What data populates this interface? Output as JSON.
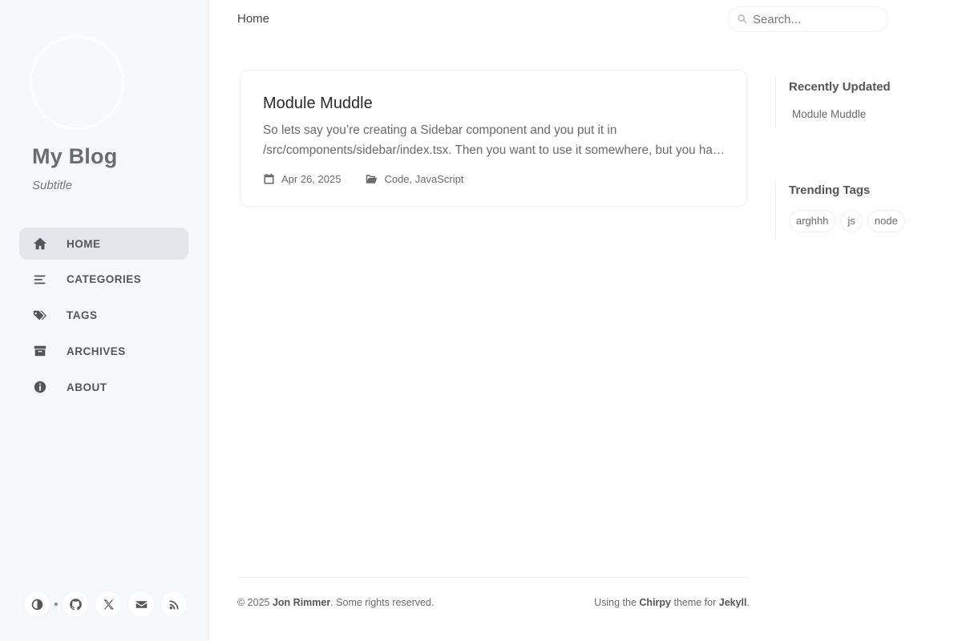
{
  "sidebar": {
    "site_title": "My Blog",
    "subtitle": "Subtitle",
    "nav": [
      {
        "label": "HOME",
        "icon": "home-icon",
        "active": true
      },
      {
        "label": "CATEGORIES",
        "icon": "stream-icon",
        "active": false
      },
      {
        "label": "TAGS",
        "icon": "tags-icon",
        "active": false
      },
      {
        "label": "ARCHIVES",
        "icon": "archive-icon",
        "active": false
      },
      {
        "label": "ABOUT",
        "icon": "info-circle-icon",
        "active": false
      }
    ],
    "bottom_icons": [
      "theme-toggle-icon",
      "github-icon",
      "x-twitter-icon",
      "email-icon",
      "rss-icon"
    ]
  },
  "topbar": {
    "breadcrumb": "Home",
    "search_placeholder": "Search..."
  },
  "post": {
    "title": "Module Muddle",
    "excerpt_line1": "So lets say you’re creating a Sidebar component and you put it in",
    "excerpt_line2": "/src/components/sidebar/index.tsx. Then you want to use it somewhere, but you have to import it from",
    "date": "Apr 26, 2025",
    "categories": [
      "Code",
      "JavaScript"
    ]
  },
  "panel": {
    "recent_heading": "Recently Updated",
    "recent_items": [
      "Module Muddle"
    ],
    "tags_heading": "Trending Tags",
    "tags": [
      "arghhh",
      "js",
      "node"
    ]
  },
  "footer": {
    "copyright_prefix": "© 2025 ",
    "author": "Jon Rimmer",
    "copyright_suffix": ". Some rights reserved.",
    "theme_prefix": "Using the ",
    "theme_name": "Chirpy",
    "theme_mid": " theme for ",
    "platform": "Jekyll",
    "theme_suffix": "."
  },
  "colors": {
    "sidebar_bg": "#f6f8fa",
    "active_nav_bg": "#e3e7ec",
    "text": "#34343c"
  }
}
